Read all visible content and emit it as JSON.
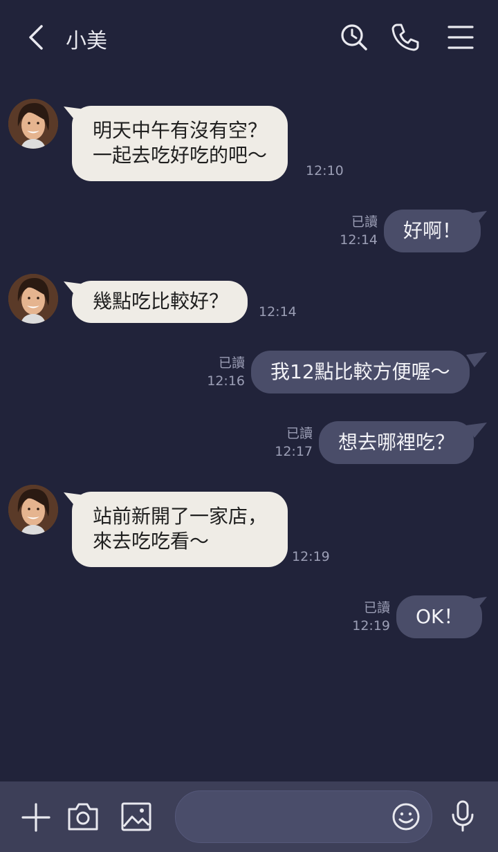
{
  "header": {
    "title": "小美"
  },
  "messages": [
    {
      "side": "in",
      "lines": [
        "明天中午有沒有空？",
        "一起去吃好吃的吧～"
      ],
      "time": "12:10"
    },
    {
      "side": "out",
      "text": "好啊！",
      "read": "已讀",
      "time": "12:14"
    },
    {
      "side": "in",
      "lines": [
        "幾點吃比較好？"
      ],
      "time": "12:14"
    },
    {
      "side": "out",
      "text": "我12點比較方便喔～",
      "read": "已讀",
      "time": "12:16"
    },
    {
      "side": "out",
      "text": "想去哪裡吃？",
      "read": "已讀",
      "time": "12:17"
    },
    {
      "side": "in",
      "lines": [
        "站前新開了一家店，",
        "來去吃吃看～"
      ],
      "time": "12:19"
    },
    {
      "side": "out",
      "text": "OK！",
      "read": "已讀",
      "time": "12:19"
    }
  ],
  "input": {
    "placeholder": ""
  },
  "icons": [
    "back-icon",
    "search-icon",
    "phone-icon",
    "menu-icon",
    "plus-icon",
    "camera-icon",
    "image-icon",
    "emoji-icon",
    "mic-icon"
  ]
}
